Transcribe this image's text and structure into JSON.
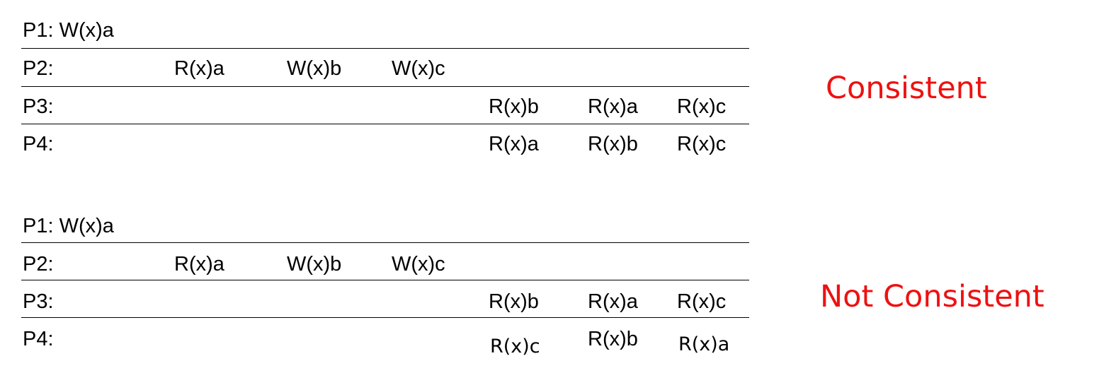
{
  "verdict_color": "#ee1111",
  "line_color": "#000000",
  "diagrams": [
    {
      "verdict": "Consistent",
      "processes": [
        {
          "label": "P1: W(x)a",
          "ops": []
        },
        {
          "label": "P2:",
          "ops": [
            "R(x)a",
            "W(x)b",
            "W(x)c"
          ]
        },
        {
          "label": "P3:",
          "ops": [
            "R(x)b",
            "R(x)a",
            "R(x)c"
          ]
        },
        {
          "label": "P4:",
          "ops": [
            "R(x)a",
            "R(x)b",
            "R(x)c"
          ]
        }
      ]
    },
    {
      "verdict": "Not Consistent",
      "processes": [
        {
          "label": "P1: W(x)a",
          "ops": []
        },
        {
          "label": "P2:",
          "ops": [
            "R(x)a",
            "W(x)b",
            "W(x)c"
          ]
        },
        {
          "label": "P3:",
          "ops": [
            "R(x)b",
            "R(x)a",
            "R(x)c"
          ]
        },
        {
          "label": "P4:",
          "ops": [
            "R(x)c",
            "R(x)b",
            "R(x)a"
          ]
        }
      ]
    }
  ]
}
